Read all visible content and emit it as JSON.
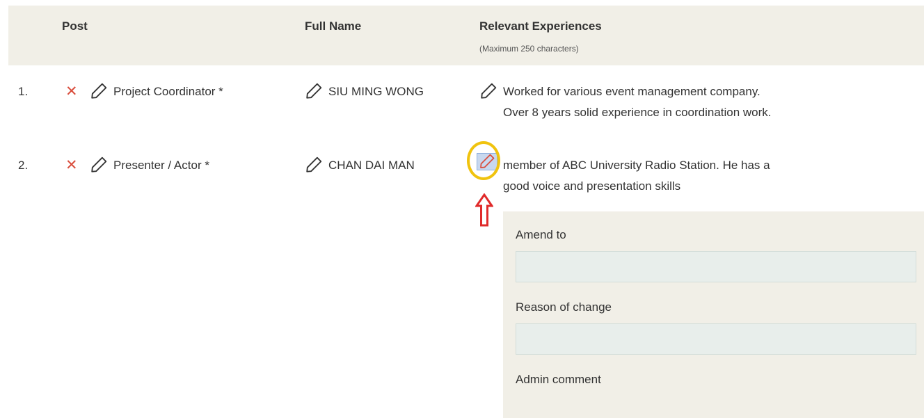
{
  "header": {
    "post_label": "Post",
    "full_name_label": "Full Name",
    "experience_label": "Relevant Experiences",
    "experience_note": "(Maximum 250 characters)"
  },
  "rows": [
    {
      "number": "1.",
      "post": "Project Coordinator *",
      "full_name": "SIU MING WONG",
      "experience_line1": "Worked for various event management company.",
      "experience_line2": "Over 8 years solid experience in coordination work."
    },
    {
      "number": "2.",
      "post": "Presenter / Actor *",
      "full_name": "CHAN DAI MAN",
      "experience_line1": "member of ABC University Radio Station. He has a",
      "experience_line2": "good voice and presentation skills"
    }
  ],
  "amend_panel": {
    "amend_label": "Amend to",
    "amend_value": "",
    "reason_label": "Reason of change",
    "reason_value": "",
    "admin_label": "Admin comment"
  },
  "colors": {
    "header_bg": "#f1efe7",
    "delete_icon": "#d94c3b",
    "focus_ring": "#f0c30e",
    "arrow": "#e02a2a",
    "active_pencil": "#d94c3b"
  },
  "icons": [
    "delete-icon",
    "pencil-icon",
    "up-arrow-icon"
  ]
}
